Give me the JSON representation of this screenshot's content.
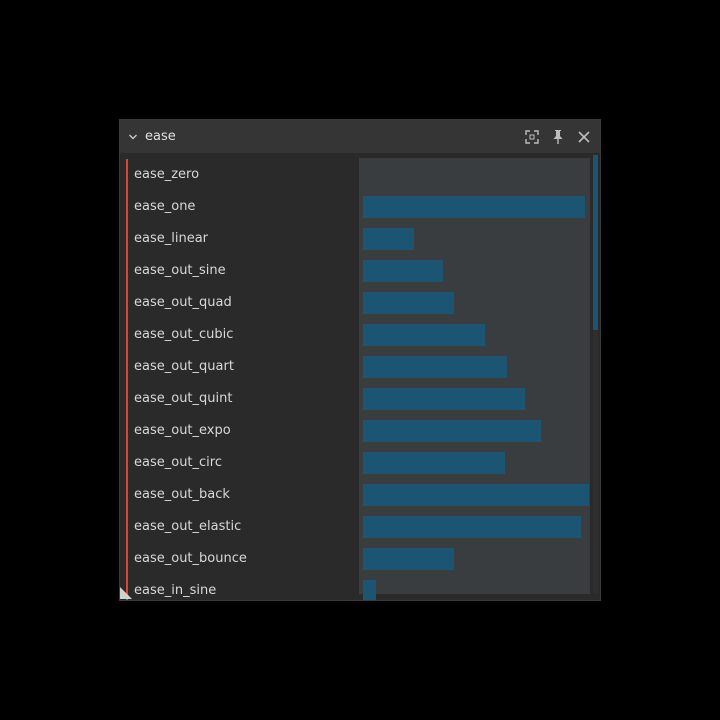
{
  "window": {
    "title": "ease"
  },
  "icons": {
    "collapse": "chevron-down-icon",
    "maximize": "maximize-icon",
    "pin": "pin-icon",
    "close": "close-icon"
  },
  "colors": {
    "bar": "#1c5572",
    "marker": "#d9443c",
    "track": "#3a3d40"
  },
  "rows": [
    {
      "label": "ease_zero",
      "value": 0.0
    },
    {
      "label": "ease_one",
      "value": 1.0
    },
    {
      "label": "ease_linear",
      "value": 0.23
    },
    {
      "label": "ease_out_sine",
      "value": 0.36
    },
    {
      "label": "ease_out_quad",
      "value": 0.41
    },
    {
      "label": "ease_out_cubic",
      "value": 0.55
    },
    {
      "label": "ease_out_quart",
      "value": 0.65
    },
    {
      "label": "ease_out_quint",
      "value": 0.73
    },
    {
      "label": "ease_out_expo",
      "value": 0.8
    },
    {
      "label": "ease_out_circ",
      "value": 0.64
    },
    {
      "label": "ease_out_back",
      "value": 1.02
    },
    {
      "label": "ease_out_elastic",
      "value": 0.98
    },
    {
      "label": "ease_out_bounce",
      "value": 0.41
    },
    {
      "label": "ease_in_sine",
      "value": 0.06
    }
  ]
}
